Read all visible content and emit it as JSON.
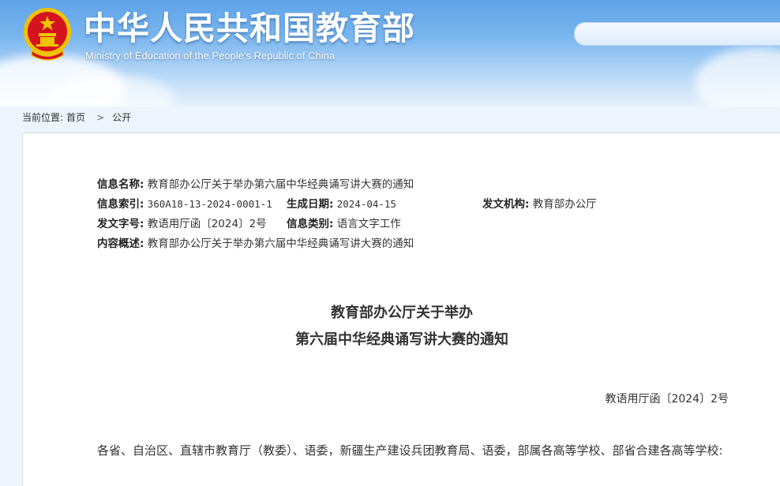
{
  "header": {
    "title_cn": "中华人民共和国教育部",
    "title_en": "Ministry of Education of the People's Republic of China"
  },
  "breadcrumb": {
    "prefix": "当前位置:",
    "home": "首页",
    "separator": ">",
    "current": "公开"
  },
  "meta": {
    "name_label": "信息名称:",
    "name_value": "教育部办公厅关于举办第六届中华经典诵写讲大赛的通知",
    "index_label": "信息索引:",
    "index_value": "360A18-13-2024-0001-1",
    "date_label": "生成日期:",
    "date_value": "2024-04-15",
    "org_label": "发文机构:",
    "org_value": "教育部办公厅",
    "docno_label": "发文字号:",
    "docno_value": "教语用厅函〔2024〕2号",
    "category_label": "信息类别:",
    "category_value": "语言文字工作",
    "summary_label": "内容概述:",
    "summary_value": "教育部办公厅关于举办第六届中华经典诵写讲大赛的通知"
  },
  "document": {
    "title_line1": "教育部办公厅关于举办",
    "title_line2": "第六届中华经典诵写讲大赛的通知",
    "doc_number": "教语用厅函〔2024〕2号",
    "paragraph": "各省、自治区、直辖市教育厅（教委）、语委，新疆生产建设兵团教育局、语委，部属各高等学校、部省合建各高等学校:"
  },
  "colors": {
    "header_blue": "#5ea3e8",
    "emblem_red": "#d4141c",
    "emblem_gold": "#f2c200"
  }
}
